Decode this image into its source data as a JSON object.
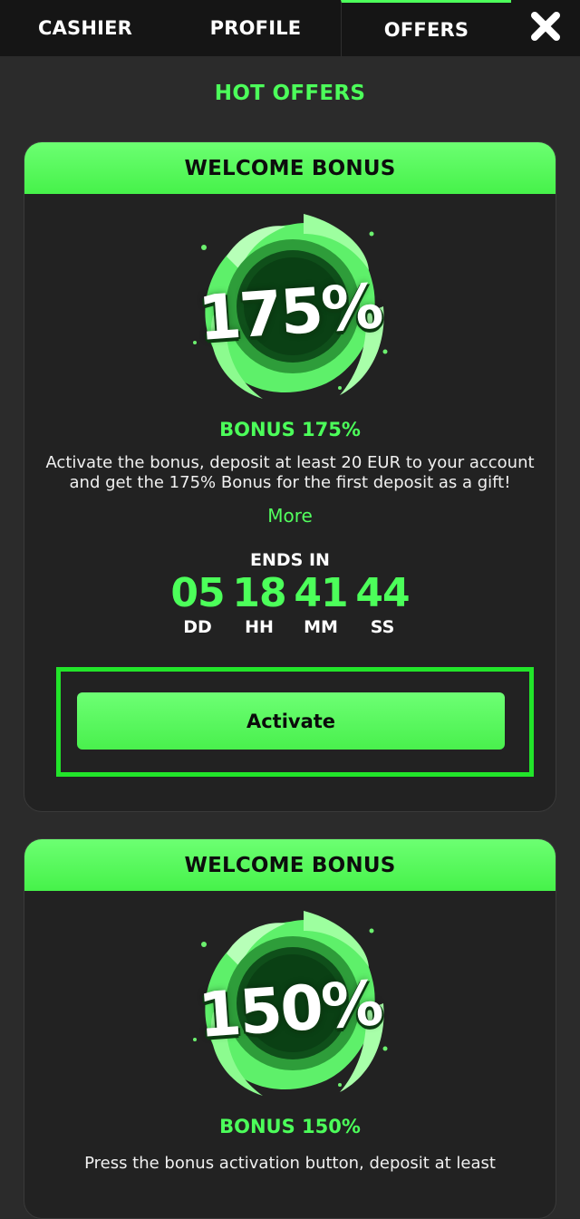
{
  "nav": {
    "tabs": [
      {
        "label": "CASHIER"
      },
      {
        "label": "PROFILE"
      },
      {
        "label": "OFFERS"
      }
    ],
    "close_icon": "close-icon"
  },
  "section_title": "HOT OFFERS",
  "offers": [
    {
      "header": "WELCOME BONUS",
      "percent": "175%",
      "name": "BONUS 175%",
      "description": "Activate the bonus, deposit at least 20 EUR to your account and get the 175% Bonus for the first deposit as a gift!",
      "more": "More",
      "ends_label": "ENDS IN",
      "countdown": {
        "dd": "05",
        "hh": "18",
        "mm": "41",
        "ss": "44",
        "dd_label": "DD",
        "hh_label": "HH",
        "mm_label": "MM",
        "ss_label": "SS"
      },
      "button": "Activate"
    },
    {
      "header": "WELCOME BONUS",
      "percent": "150%",
      "name": "BONUS 150%",
      "description": "Press the bonus activation button, deposit at least"
    }
  ],
  "colors": {
    "accent": "#4cff5a",
    "background": "#2b2b2b",
    "card": "#222222",
    "nav": "#151515",
    "highlight_frame": "#22e52a"
  }
}
